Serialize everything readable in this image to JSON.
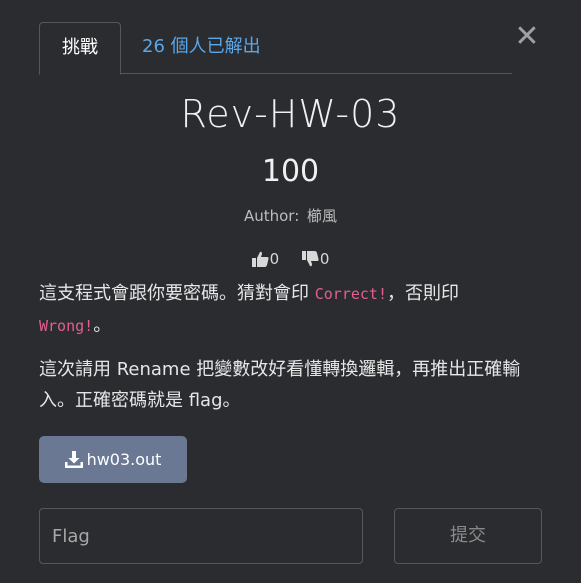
{
  "tabs": {
    "challenge": "挑戰",
    "solves": "26 個人已解出"
  },
  "close_label": "✕",
  "challenge": {
    "name": "Rev-HW-03",
    "points": "100",
    "author_label": "Author:",
    "author_name": "櫛風"
  },
  "votes": {
    "likes": "0",
    "dislikes": "0"
  },
  "description": {
    "p1_text_a": "這支程式會跟你要密碼。猜對會印 ",
    "p1_code_correct": "Correct!",
    "p1_text_b": "，否則印",
    "p1_code_wrong": "Wrong!",
    "p1_text_c": "。",
    "p2": "這次請用 Rename 把變數改好看懂轉換邏輯，再推出正確輸入。正確密碼就是 flag。"
  },
  "file": {
    "name": "hw03.out"
  },
  "flag_input": {
    "placeholder": "Flag",
    "value": ""
  },
  "submit_label": "提交",
  "colors": {
    "background": "#2b2c30",
    "accent_link": "#5aa7ea",
    "code": "#e25f8f",
    "file_button": "#6a7894"
  }
}
